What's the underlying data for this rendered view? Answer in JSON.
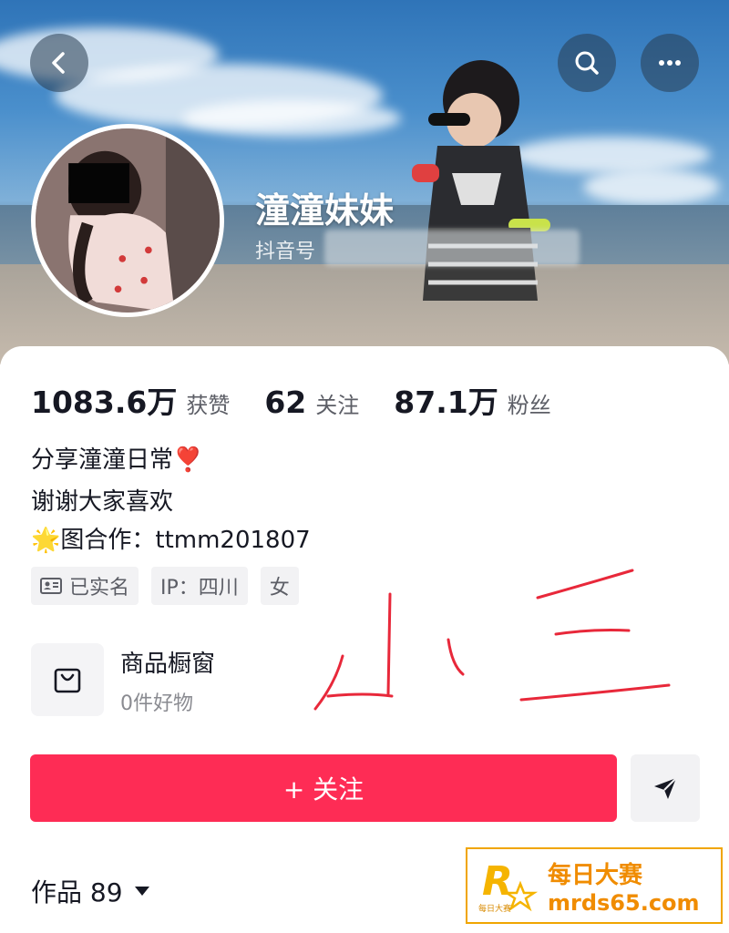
{
  "profile": {
    "username": "潼潼妹妹",
    "douyin_id_label": "抖音号"
  },
  "stats": [
    {
      "value": "1083.6万",
      "label": "获赞"
    },
    {
      "value": "62",
      "label": "关注"
    },
    {
      "value": "87.1万",
      "label": "粉丝"
    }
  ],
  "bio": {
    "line1": "分享潼潼日常",
    "line1_emoji": "❣️",
    "line2": "谢谢大家喜欢",
    "line3_emoji": "🌟",
    "line3": "图合作：ttmm201807"
  },
  "tags": {
    "verified": "已实名",
    "ip": "IP：四川",
    "gender": "女"
  },
  "shop": {
    "title": "商品橱窗",
    "subtitle": "0件好物"
  },
  "actions": {
    "follow_label": "+ 关注"
  },
  "works": {
    "label": "作品 89"
  },
  "annotation": {
    "handwriting": "小三"
  },
  "watermark": {
    "logo_letter": "R",
    "logo_caption": "每日大赛",
    "line1": "每日大赛",
    "line2": "mrds65.com"
  },
  "colors": {
    "follow_button": "#fe2c55",
    "watermark": "#f08c00",
    "scribble": "#e8283a"
  },
  "icons": {
    "back": "back-arrow-icon",
    "search": "search-icon",
    "more": "more-dots-icon",
    "id_card": "id-card-icon",
    "shop": "shopping-bag-icon",
    "send": "send-icon",
    "dropdown": "caret-down-icon"
  }
}
